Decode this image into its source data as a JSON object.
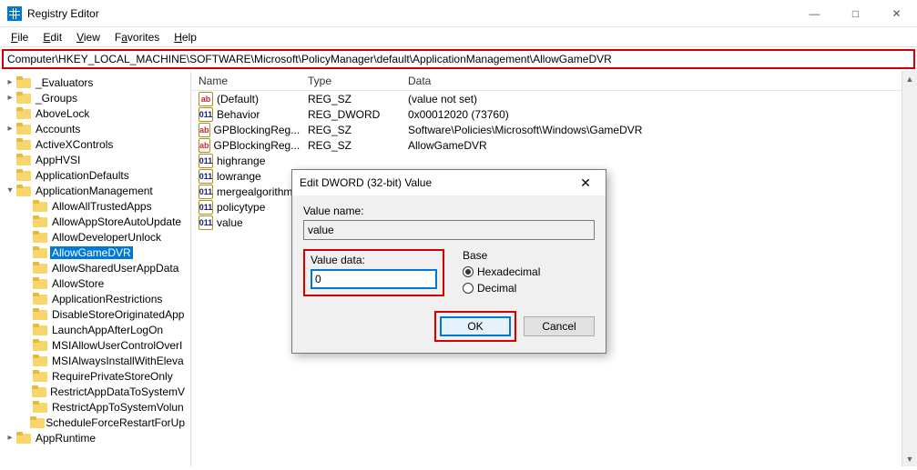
{
  "window": {
    "title": "Registry Editor"
  },
  "winbtns": {
    "min": "—",
    "max": "□",
    "close": "✕"
  },
  "menu": {
    "file": "File",
    "edit": "Edit",
    "view": "View",
    "favorites": "Favorites",
    "help": "Help",
    "file_u": "F",
    "edit_u": "E",
    "view_u": "V",
    "fav_u": "a",
    "help_u": "H",
    "file_rest": "ile",
    "edit_rest": "dit",
    "view_rest": "iew",
    "fav_pre": "F",
    "fav_rest": "vorites",
    "help_rest": "elp"
  },
  "address": {
    "path": "Computer\\HKEY_LOCAL_MACHINE\\SOFTWARE\\Microsoft\\PolicyManager\\default\\ApplicationManagement\\AllowGameDVR"
  },
  "tree": [
    {
      "indent": 0,
      "twisty": "▸",
      "label": "_Evaluators"
    },
    {
      "indent": 0,
      "twisty": "▸",
      "label": "_Groups"
    },
    {
      "indent": 0,
      "twisty": "",
      "label": "AboveLock"
    },
    {
      "indent": 0,
      "twisty": "▸",
      "label": "Accounts"
    },
    {
      "indent": 0,
      "twisty": "",
      "label": "ActiveXControls"
    },
    {
      "indent": 0,
      "twisty": "",
      "label": "AppHVSI"
    },
    {
      "indent": 0,
      "twisty": "",
      "label": "ApplicationDefaults"
    },
    {
      "indent": 0,
      "twisty": "▾",
      "label": "ApplicationManagement"
    },
    {
      "indent": 1,
      "twisty": "",
      "label": "AllowAllTrustedApps"
    },
    {
      "indent": 1,
      "twisty": "",
      "label": "AllowAppStoreAutoUpdate"
    },
    {
      "indent": 1,
      "twisty": "",
      "label": "AllowDeveloperUnlock"
    },
    {
      "indent": 1,
      "twisty": "",
      "label": "AllowGameDVR",
      "selected": true
    },
    {
      "indent": 1,
      "twisty": "",
      "label": "AllowSharedUserAppData"
    },
    {
      "indent": 1,
      "twisty": "",
      "label": "AllowStore"
    },
    {
      "indent": 1,
      "twisty": "",
      "label": "ApplicationRestrictions"
    },
    {
      "indent": 1,
      "twisty": "",
      "label": "DisableStoreOriginatedApp"
    },
    {
      "indent": 1,
      "twisty": "",
      "label": "LaunchAppAfterLogOn"
    },
    {
      "indent": 1,
      "twisty": "",
      "label": "MSIAllowUserControlOverI"
    },
    {
      "indent": 1,
      "twisty": "",
      "label": "MSIAlwaysInstallWithEleva"
    },
    {
      "indent": 1,
      "twisty": "",
      "label": "RequirePrivateStoreOnly"
    },
    {
      "indent": 1,
      "twisty": "",
      "label": "RestrictAppDataToSystemV"
    },
    {
      "indent": 1,
      "twisty": "",
      "label": "RestrictAppToSystemVolun"
    },
    {
      "indent": 1,
      "twisty": "",
      "label": "ScheduleForceRestartForUp"
    },
    {
      "indent": 0,
      "twisty": "▸",
      "label": "AppRuntime"
    }
  ],
  "columns": {
    "name": "Name",
    "type": "Type",
    "data": "Data"
  },
  "values": [
    {
      "icon": "sz",
      "name": "(Default)",
      "type": "REG_SZ",
      "data": "(value not set)"
    },
    {
      "icon": "dw",
      "name": "Behavior",
      "type": "REG_DWORD",
      "data": "0x00012020 (73760)"
    },
    {
      "icon": "sz",
      "name": "GPBlockingReg...",
      "type": "REG_SZ",
      "data": "Software\\Policies\\Microsoft\\Windows\\GameDVR"
    },
    {
      "icon": "sz",
      "name": "GPBlockingReg...",
      "type": "REG_SZ",
      "data": "AllowGameDVR"
    },
    {
      "icon": "dw",
      "name": "highrange",
      "type": "",
      "data": ""
    },
    {
      "icon": "dw",
      "name": "lowrange",
      "type": "",
      "data": ""
    },
    {
      "icon": "dw",
      "name": "mergealgorithm",
      "type": "",
      "data": ""
    },
    {
      "icon": "dw",
      "name": "policytype",
      "type": "",
      "data": ""
    },
    {
      "icon": "dw",
      "name": "value",
      "type": "",
      "data": ""
    }
  ],
  "icon_glyph": {
    "sz": "ab",
    "dw": "011"
  },
  "dialog": {
    "title": "Edit DWORD (32-bit) Value",
    "close": "✕",
    "value_name_label": "Value name:",
    "value_name": "value",
    "value_data_label": "Value data:",
    "value_data": "0",
    "base_label": "Base",
    "hex": "Hexadecimal",
    "dec": "Decimal",
    "ok": "OK",
    "cancel": "Cancel"
  }
}
